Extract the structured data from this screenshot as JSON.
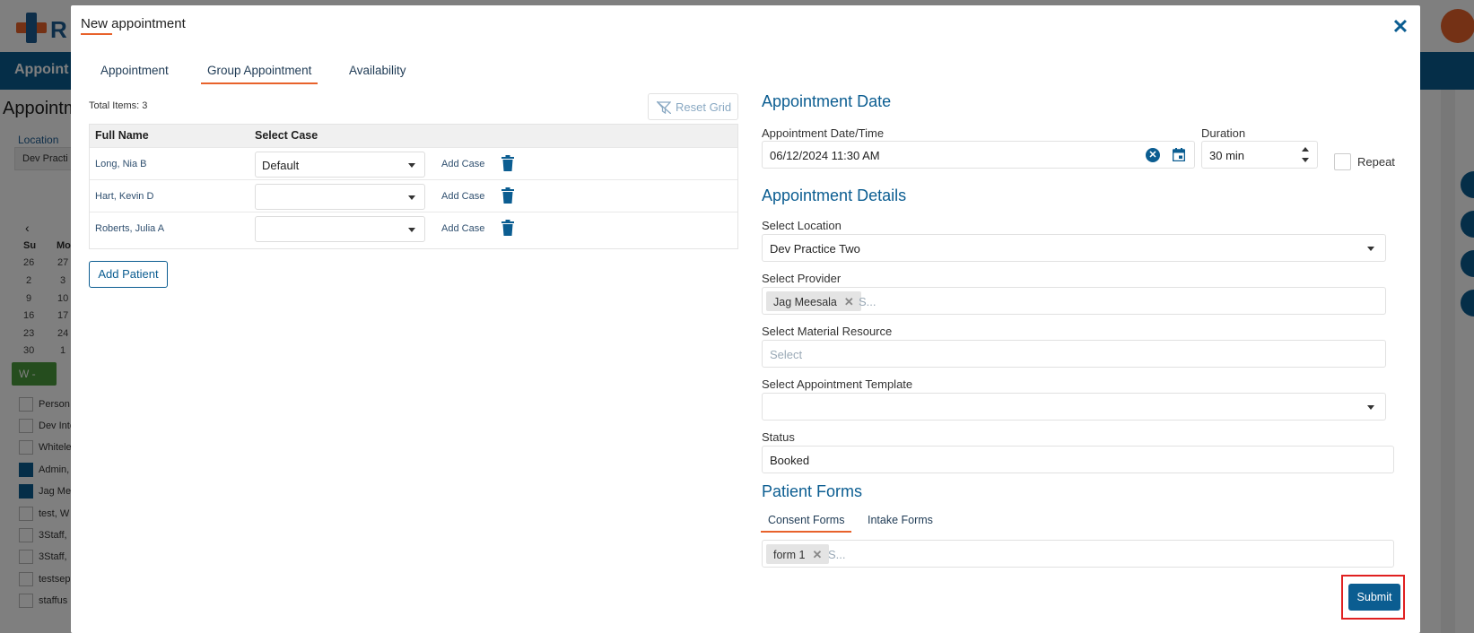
{
  "background": {
    "logo_text": "R",
    "nav_label": "Appoint",
    "page_title": "Appointm",
    "location_label": "Location",
    "location_value": "Dev Practi",
    "calendar": {
      "headers": [
        "Su",
        "Mo"
      ],
      "rows": [
        [
          "26",
          "27"
        ],
        [
          "2",
          "3"
        ],
        [
          "9",
          "10"
        ],
        [
          "16",
          "17"
        ],
        [
          "23",
          "24"
        ],
        [
          "30",
          "1"
        ]
      ]
    },
    "w_button": "W -",
    "list_header": "Person",
    "list_items": [
      {
        "label": "Dev Inte",
        "checked": false
      },
      {
        "label": "Whitele",
        "checked": false
      },
      {
        "label": "Admin,",
        "checked": true
      },
      {
        "label": "Jag Mee",
        "checked": true
      },
      {
        "label": "test, W",
        "checked": false
      },
      {
        "label": "3Staff,",
        "checked": false
      },
      {
        "label": "3Staff,",
        "checked": false
      },
      {
        "label": "testsep",
        "checked": false
      },
      {
        "label": "staffus",
        "checked": false
      }
    ]
  },
  "modal": {
    "title": "New appointment",
    "tabs": [
      {
        "label": "Appointment",
        "active": false
      },
      {
        "label": "Group Appointment",
        "active": true
      },
      {
        "label": "Availability",
        "active": false
      }
    ],
    "grid": {
      "total_items": "Total Items: 3",
      "reset_label": "Reset Grid",
      "columns": [
        "Full Name",
        "Select Case"
      ],
      "rows": [
        {
          "name": "Long, Nia B",
          "case": "Default",
          "add_case": "Add Case"
        },
        {
          "name": "Hart, Kevin D",
          "case": "",
          "add_case": "Add Case"
        },
        {
          "name": "Roberts, Julia A",
          "case": "",
          "add_case": "Add Case"
        }
      ],
      "add_patient": "Add Patient"
    },
    "appointment_date": {
      "section_title": "Appointment Date",
      "datetime_label": "Appointment Date/Time",
      "datetime_value": "06/12/2024 11:30 AM",
      "duration_label": "Duration",
      "duration_value": "30 min",
      "repeat_label": "Repeat"
    },
    "details": {
      "section_title": "Appointment Details",
      "location_label": "Select Location",
      "location_value": "Dev Practice Two",
      "provider_label": "Select Provider",
      "provider_chip": "Jag Meesala",
      "provider_placeholder": "S...",
      "material_label": "Select Material Resource",
      "material_placeholder": "Select",
      "template_label": "Select Appointment Template",
      "template_value": "",
      "status_label": "Status",
      "status_value": "Booked"
    },
    "forms": {
      "section_title": "Patient Forms",
      "tabs": [
        {
          "label": "Consent Forms",
          "active": true
        },
        {
          "label": "Intake Forms",
          "active": false
        }
      ],
      "chip": "form 1",
      "placeholder": "S..."
    },
    "submit_label": "Submit"
  },
  "colors": {
    "primary": "#0b5d91",
    "accent": "#e8622b",
    "highlight": "#e02020"
  }
}
